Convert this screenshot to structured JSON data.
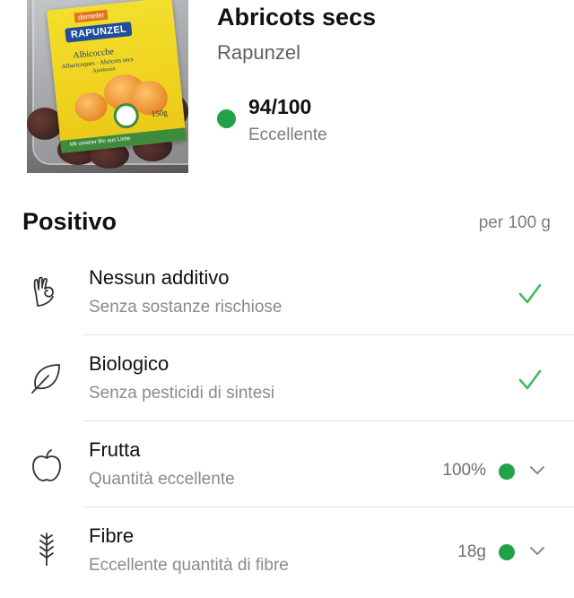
{
  "product": {
    "name": "Abricots secs",
    "brand": "Rapunzel",
    "score": "94/100",
    "score_label": "Eccellente",
    "score_color": "#21a249",
    "image_text": {
      "demeter": "demeter",
      "brand": "RAPUNZEL",
      "line1": "Albicocche",
      "line2": "Albaricoques · Abricots secs",
      "line3": "Aprikozen",
      "weight": "150g",
      "band": "Mit unserer Bio aus Liebe"
    }
  },
  "section": {
    "title": "Positivo",
    "unit": "per 100 g"
  },
  "items": [
    {
      "label": "Nessun additivo",
      "sub": "Senza sostanze rischiose",
      "icon": "hand-ok-icon",
      "indicator": "check"
    },
    {
      "label": "Biologico",
      "sub": "Senza pesticidi di sintesi",
      "icon": "leaf-icon",
      "indicator": "check"
    },
    {
      "label": "Frutta",
      "sub": "Quantità eccellente",
      "icon": "apple-icon",
      "value": "100%",
      "indicator": "dot"
    },
    {
      "label": "Fibre",
      "sub": "Eccellente quantità di fibre",
      "icon": "wheat-icon",
      "value": "18g",
      "indicator": "dot"
    }
  ],
  "colors": {
    "good": "#21a249",
    "check": "#3dbb5e"
  }
}
